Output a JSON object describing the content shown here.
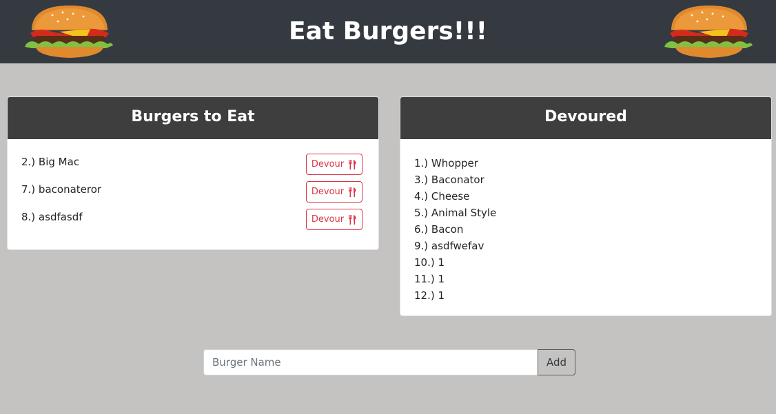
{
  "header": {
    "title": "Eat Burgers!!!",
    "left_image": "burger-image",
    "right_image": "burger-image"
  },
  "to_eat": {
    "title": "Burgers to Eat",
    "items": [
      {
        "name": "2.) Big Mac",
        "button": "Devour"
      },
      {
        "name": "7.) baconateror",
        "button": "Devour"
      },
      {
        "name": "8.) asdfasdf",
        "button": "Devour"
      }
    ],
    "button_icon": "utensils-icon"
  },
  "devoured": {
    "title": "Devoured",
    "items": [
      "1.) Whopper",
      "3.) Baconator",
      "4.) Cheese",
      "5.) Animal Style",
      "6.) Bacon",
      "9.) asdfwefav",
      "10.) 1",
      "11.) 1",
      "12.) 1"
    ]
  },
  "form": {
    "placeholder": "Burger Name",
    "value": "",
    "add_label": "Add"
  },
  "colors": {
    "header_bg": "#343a40",
    "page_bg": "#c4c3c1",
    "card_header_bg": "#3e3e3e",
    "danger": "#dc3545"
  }
}
